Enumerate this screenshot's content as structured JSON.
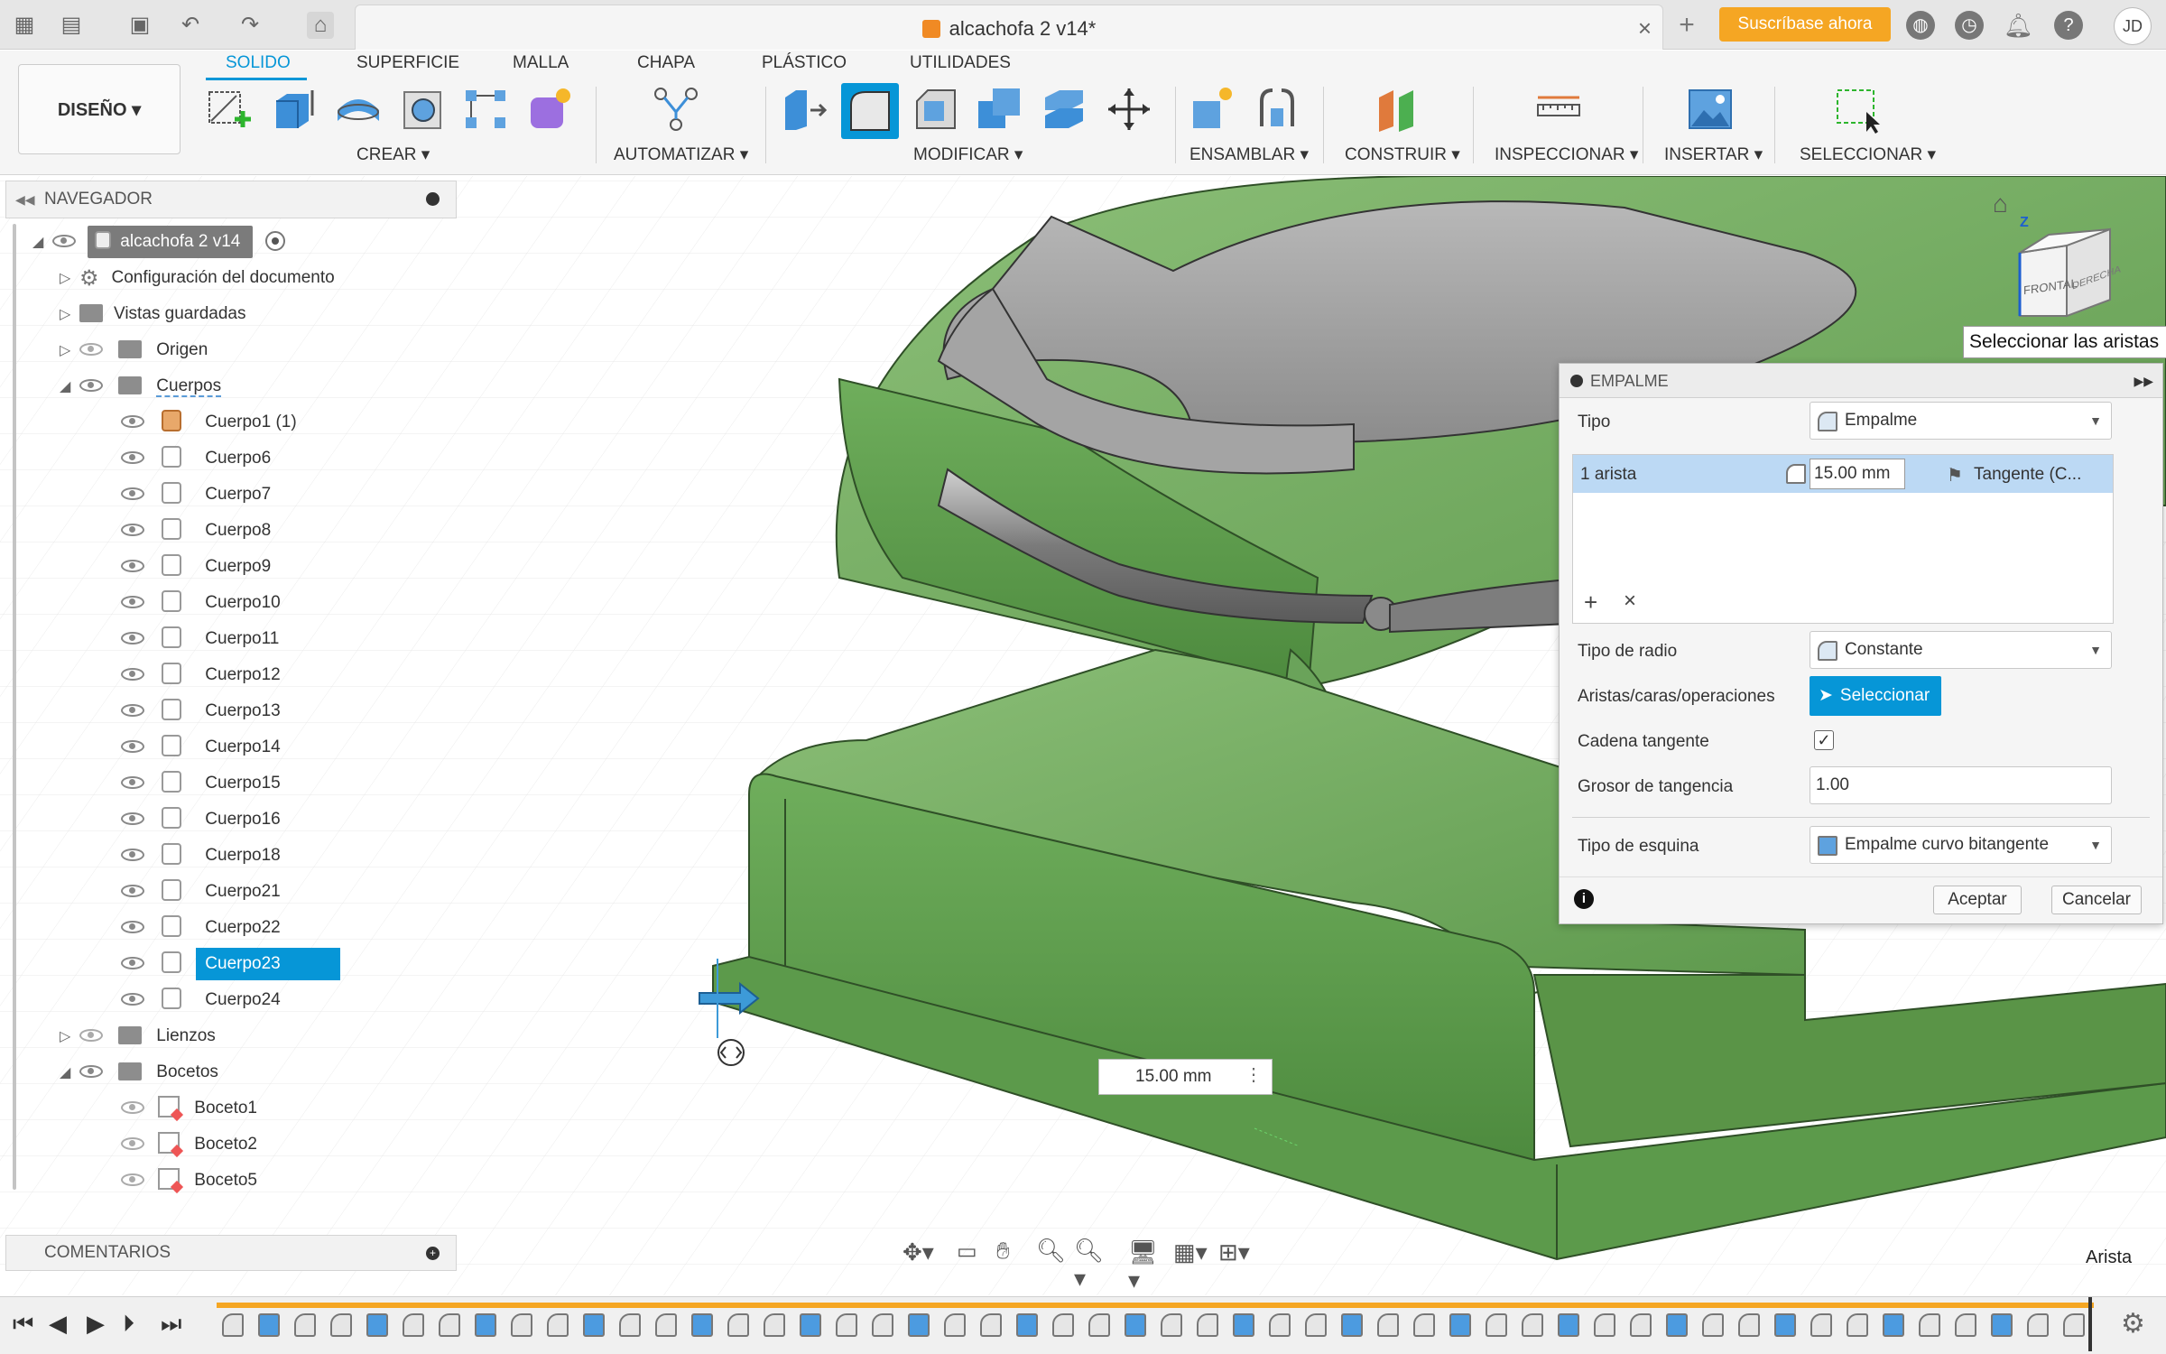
{
  "app": {
    "document_title": "alcachofa 2 v14*",
    "subscribe_label": "Suscríbase ahora",
    "user_initials": "JD"
  },
  "workspace": {
    "label": "DISEÑO"
  },
  "ribbon": {
    "tabs": [
      "SOLIDO",
      "SUPERFICIE",
      "MALLA",
      "CHAPA",
      "PLÁSTICO",
      "UTILIDADES"
    ],
    "groups": [
      "CREAR",
      "AUTOMATIZAR",
      "MODIFICAR",
      "ENSAMBLAR",
      "CONSTRUIR",
      "INSPECCIONAR",
      "INSERTAR",
      "SELECCIONAR"
    ]
  },
  "browser": {
    "title": "NAVEGADOR",
    "root": "alcachofa 2 v14",
    "items": [
      {
        "label": "Configuración del documento"
      },
      {
        "label": "Vistas guardadas"
      },
      {
        "label": "Origen"
      },
      {
        "label": "Cuerpos"
      },
      {
        "label": "Cuerpo1 (1)"
      },
      {
        "label": "Cuerpo6"
      },
      {
        "label": "Cuerpo7"
      },
      {
        "label": "Cuerpo8"
      },
      {
        "label": "Cuerpo9"
      },
      {
        "label": "Cuerpo10"
      },
      {
        "label": "Cuerpo11"
      },
      {
        "label": "Cuerpo12"
      },
      {
        "label": "Cuerpo13"
      },
      {
        "label": "Cuerpo14"
      },
      {
        "label": "Cuerpo15"
      },
      {
        "label": "Cuerpo16"
      },
      {
        "label": "Cuerpo18"
      },
      {
        "label": "Cuerpo21"
      },
      {
        "label": "Cuerpo22"
      },
      {
        "label": "Cuerpo23"
      },
      {
        "label": "Cuerpo24"
      },
      {
        "label": "Lienzos"
      },
      {
        "label": "Bocetos"
      },
      {
        "label": "Boceto1"
      },
      {
        "label": "Boceto2"
      },
      {
        "label": "Boceto5"
      }
    ]
  },
  "comments": {
    "title": "COMENTARIOS"
  },
  "viewcube": {
    "front": "FRONTAL",
    "right": "DERECHA",
    "axis": "Z"
  },
  "tooltip": {
    "text": "Seleccionar las aristas"
  },
  "fillet": {
    "title": "EMPALME",
    "type_label": "Tipo",
    "type_value": "Empalme",
    "edge_row": {
      "label": "1 arista",
      "radius": "15.00 mm",
      "continuity": "Tangente (C..."
    },
    "radius_type_label": "Tipo de radio",
    "radius_type_value": "Constante",
    "select_label": "Aristas/caras/operaciones",
    "select_button": "Seleccionar",
    "tangent_chain_label": "Cadena tangente",
    "tangent_chain_checked": true,
    "tangency_weight_label": "Grosor de tangencia",
    "tangency_weight_value": "1.00",
    "corner_type_label": "Tipo de esquina",
    "corner_type_value": "Empalme curvo bitangente",
    "ok": "Aceptar",
    "cancel": "Cancelar"
  },
  "canvas": {
    "measure_value": "15.00 mm",
    "status": "Arista"
  },
  "colors": {
    "accent": "#0696d7",
    "model_green": "#5f9a4e",
    "model_gray": "#9a9a9a",
    "subscribe": "#f5a623"
  }
}
